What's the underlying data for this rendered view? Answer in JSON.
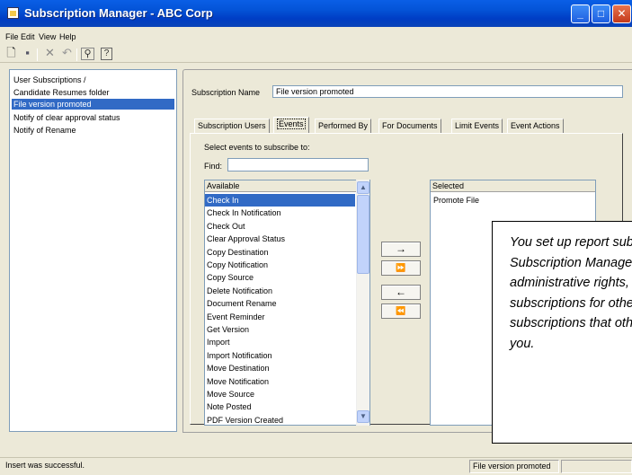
{
  "window": {
    "title": "Subscription Manager - ABC Corp",
    "buttons": {
      "minimize": "_",
      "maximize": "□",
      "close": "✕"
    }
  },
  "menu": [
    "File",
    "Edit",
    "View",
    "Help"
  ],
  "toolbar": {
    "icons": [
      "new-icon",
      "save-icon",
      "delete-icon",
      "undo-icon",
      "find-icon",
      "help-icon"
    ]
  },
  "left_list": {
    "items": [
      "User Subscriptions /",
      "Candidate Resumes folder",
      "File version promoted",
      "Notify of clear approval status",
      "Notify of Rename"
    ],
    "selected_index": 2
  },
  "form": {
    "name_label": "Subscription Name",
    "name_value": "File version promoted"
  },
  "tabs": [
    "Subscription Users",
    "Events",
    "Performed By",
    "For Documents",
    "Limit Events",
    "Event Actions"
  ],
  "events": {
    "instruction": "Select events to subscribe to:",
    "find_label": "Find:",
    "find_value": "",
    "available_header": "Available",
    "available": [
      "Check In",
      "Check In Notification",
      "Check Out",
      "Clear Approval Status",
      "Copy Destination",
      "Copy Notification",
      "Copy Source",
      "Delete Notification",
      "Document Rename",
      "Event Reminder",
      "Get Version",
      "Import",
      "Import Notification",
      "Move Destination",
      "Move Notification",
      "Move Source",
      "Note Posted",
      "PDF Version Created"
    ],
    "available_selected_index": 0,
    "selected_header": "Selected",
    "selected": [
      "Promote File"
    ],
    "transfer_buttons": [
      "→",
      "⏩",
      "←",
      "⏪"
    ]
  },
  "callout": {
    "text": "You set up report subscriptions in Subscription Manager. If you have administrative rights, you can set up subscriptions for other users and copy subscriptions that others have set up for you."
  },
  "statusbar": {
    "message": "Insert was successful.",
    "current": "File version promoted",
    "extra": ""
  },
  "colors": {
    "titlebar": "#0454d8",
    "selection": "#316ac5",
    "window_bg": "#ece9d8"
  }
}
